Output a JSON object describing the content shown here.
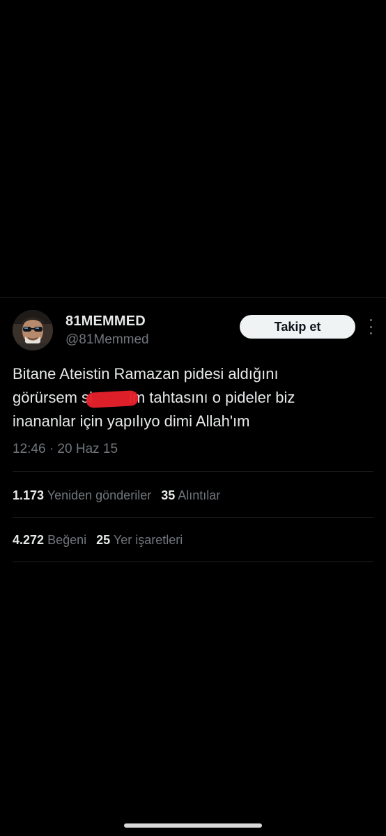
{
  "user": {
    "display_name": "81MEMMED",
    "handle": "@81Memmed",
    "avatar_icon": "profile-photo-sunglasses-man"
  },
  "follow_button": {
    "label": "Takip et"
  },
  "more_icon": "vertical-ellipsis-icon",
  "tweet": {
    "line1": "Bitane Ateistin Ramazan pidesi aldığını",
    "line2_before": "görürsem s",
    "line2_censored": "i",
    "line2_after": "im tahtasını o pideler biz",
    "line3": "inananlar için yapılıyo dimi Allah'ım",
    "censor_color": "#e8212b"
  },
  "meta": {
    "time_date": "12:46 · 20 Haz 15"
  },
  "stats": {
    "retweets_count": "1.173",
    "retweets_label": "Yeniden gönderiler",
    "quotes_count": "35",
    "quotes_label": "Alıntılar",
    "likes_count": "4.272",
    "likes_label": "Beğeni",
    "bookmarks_count": "25",
    "bookmarks_label": "Yer işaretleri"
  },
  "colors": {
    "background": "#000000",
    "primary_text": "#e7e9ea",
    "secondary_text": "#71767b",
    "button_bg": "#eff3f4"
  }
}
